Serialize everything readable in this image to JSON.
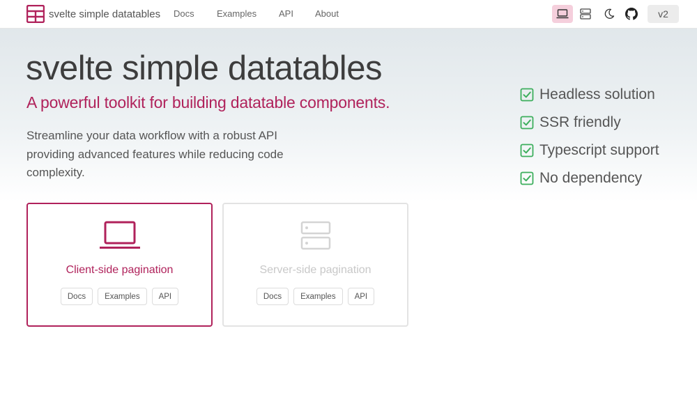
{
  "nav": {
    "brand": "svelte simple datatables",
    "links": [
      "Docs",
      "Examples",
      "API",
      "About"
    ],
    "version": "v2"
  },
  "hero": {
    "title": "svelte simple datatables",
    "subtitle": "A powerful toolkit for building datatable components.",
    "description": "Streamline your data workflow with a robust API providing advanced features while reducing code complexity."
  },
  "features": [
    "Headless solution",
    "SSR friendly",
    "Typescript support",
    "No dependency"
  ],
  "cards": [
    {
      "title": "Client-side pagination",
      "icon": "laptop-icon",
      "links": [
        "Docs",
        "Examples",
        "API"
      ]
    },
    {
      "title": "Server-side pagination",
      "icon": "server-icon",
      "links": [
        "Docs",
        "Examples",
        "API"
      ]
    }
  ],
  "colors": {
    "accent": "#b0225b",
    "check": "#3cae5c",
    "active_bg": "#f5cfdc"
  }
}
